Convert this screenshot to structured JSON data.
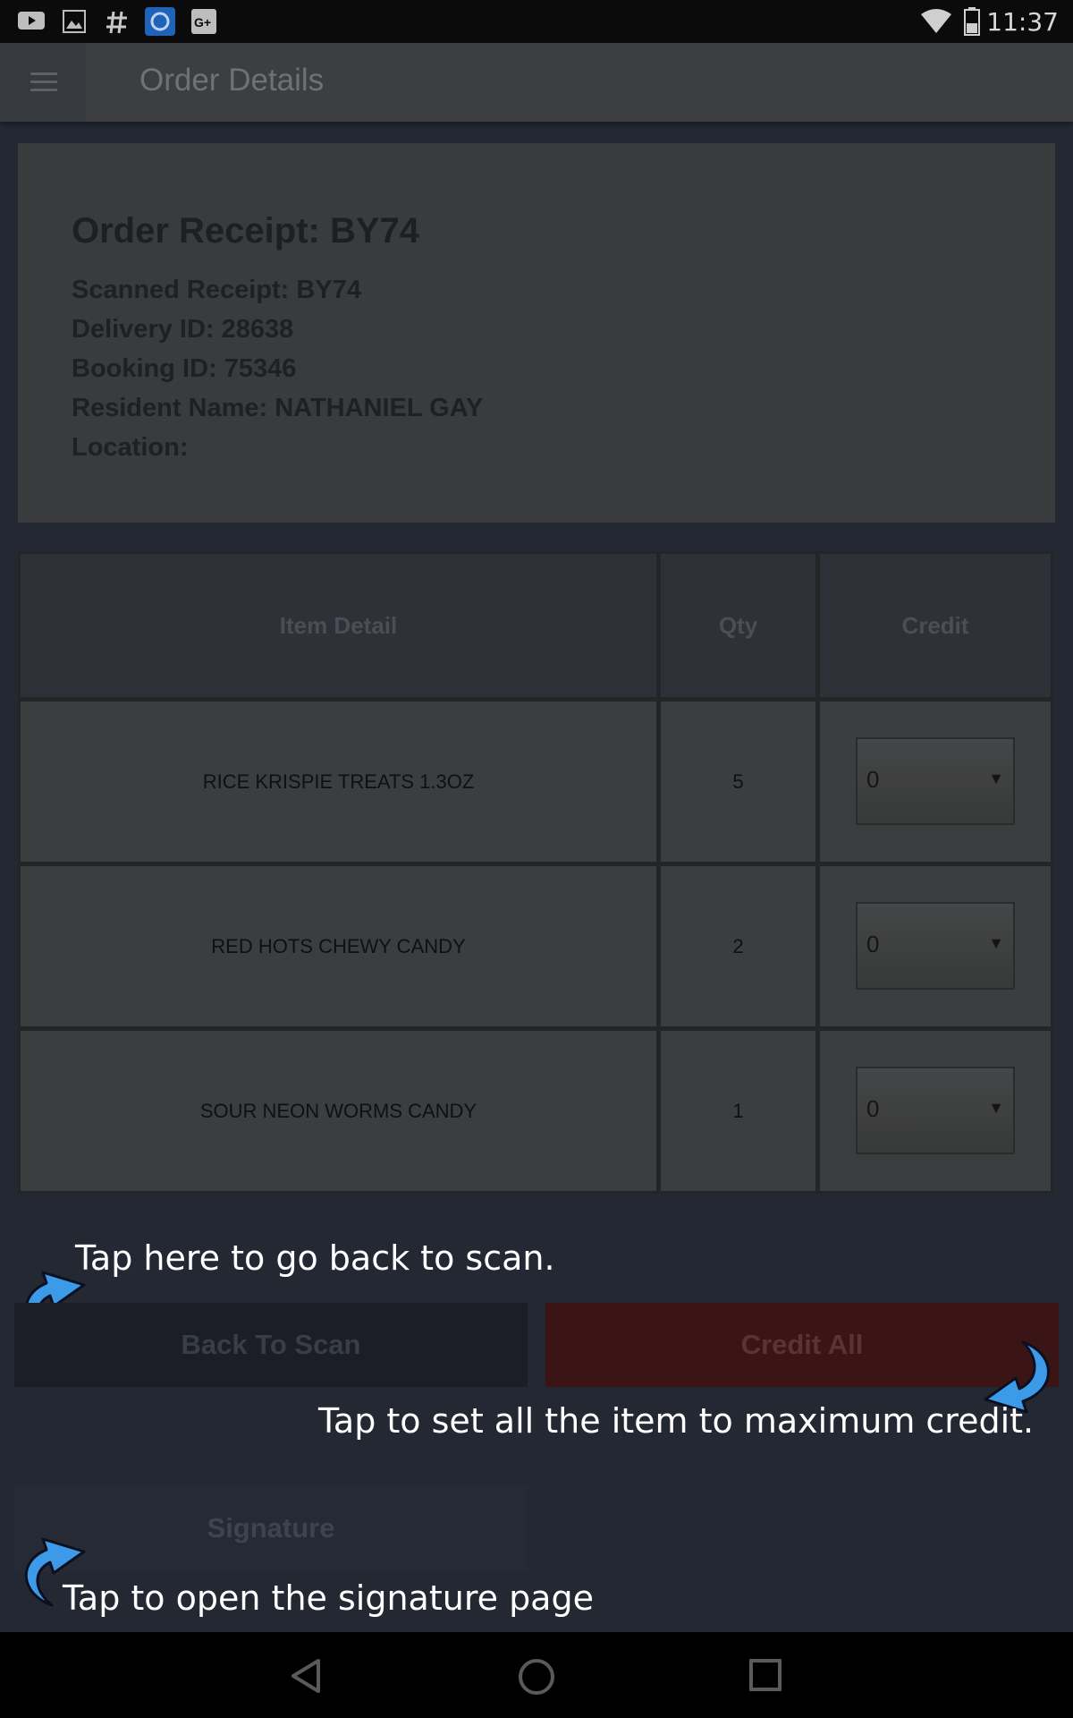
{
  "status_bar": {
    "time": "11:37",
    "left_icons": [
      "youtube-icon",
      "gallery-icon",
      "hashtag-icon",
      "sync-app-icon",
      "google-plus-icon"
    ],
    "right_icons": [
      "wifi-icon",
      "battery-icon"
    ]
  },
  "app_bar": {
    "title": "Order Details",
    "menu_icon": "hamburger-menu-icon"
  },
  "order_info": {
    "receipt_title": "Order Receipt: BY74",
    "scanned_receipt": "Scanned Receipt: BY74",
    "delivery_id": "Delivery ID: 28638",
    "booking_id": "Booking ID: 75346",
    "resident_name": "Resident Name: NATHANIEL GAY",
    "location": "Location:"
  },
  "table": {
    "headers": [
      "Item Detail",
      "Qty",
      "Credit"
    ],
    "rows": [
      {
        "item": "RICE KRISPIE TREATS 1.3OZ",
        "qty": "5",
        "credit": "0"
      },
      {
        "item": "RED HOTS CHEWY CANDY",
        "qty": "2",
        "credit": "0"
      },
      {
        "item": "SOUR NEON WORMS CANDY",
        "qty": "1",
        "credit": "0"
      }
    ]
  },
  "buttons": {
    "back_to_scan": "Back To Scan",
    "credit_all": "Credit All",
    "signature": "Signature"
  },
  "hints": {
    "back": "Tap here to go back to scan.",
    "credit": "Tap to set all the item to maximum  credit.",
    "signature": "Tap to open the signature page"
  },
  "colors": {
    "overlay_bg": "#232833",
    "hint_arrow": "#3d9ae8",
    "credit_button": "#3b1516"
  },
  "nav_bar": {
    "icons": [
      "back-triangle-icon",
      "home-circle-icon",
      "recents-square-icon"
    ]
  }
}
